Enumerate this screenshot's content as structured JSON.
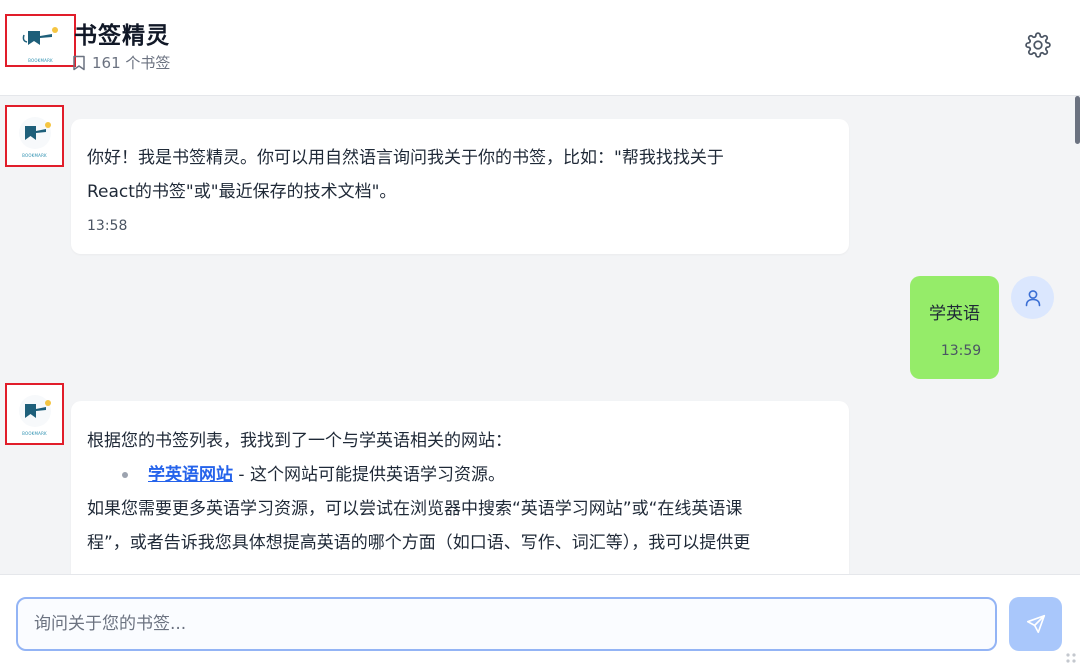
{
  "header": {
    "title": "书签精灵",
    "bookmark_count": "161 个书签",
    "logo_caption": "BOOKMARK"
  },
  "messages": [
    {
      "role": "bot",
      "text_line1": "你好！我是书签精灵。你可以用自然语言询问我关于你的书签，比如：\"帮我找找关于",
      "text_line2": "React的书签\"或\"最近保存的技术文档\"。",
      "time": "13:58"
    },
    {
      "role": "user",
      "text": "学英语",
      "time": "13:59"
    },
    {
      "role": "bot",
      "intro": "根据您的书签列表，我找到了一个与学英语相关的网站：",
      "link_text": "学英语网站",
      "link_desc": " - 这个网站可能提供英语学习资源。",
      "text_line1": "如果您需要更多英语学习资源，可以尝试在浏览器中搜索“英语学习网站”或“在线英语课",
      "text_line2": "程”，或者告诉我您具体想提高英语的哪个方面（如口语、写作、词汇等），我可以提供更"
    }
  ],
  "input": {
    "placeholder": "询问关于您的书签...",
    "value": ""
  },
  "icons": {
    "settings": "gear-icon",
    "bookmark": "bookmark-icon",
    "user": "user-icon",
    "send": "send-icon",
    "logo": "bookmark-genie-logo"
  },
  "colors": {
    "accent": "#2563eb",
    "user_bubble": "#95ec69",
    "highlight_box": "#e11d2a",
    "send_button": "#a9c7fb"
  }
}
